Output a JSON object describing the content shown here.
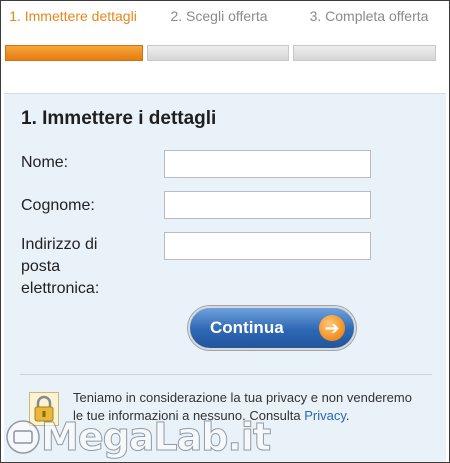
{
  "steps": [
    {
      "label": "1. Immettere dettagli",
      "active": true
    },
    {
      "label": "2. Scegli offerta",
      "active": false
    },
    {
      "label": "3. Completa offerta",
      "active": false
    }
  ],
  "form": {
    "title": "1. Immettere i dettagli",
    "first_name_label": "Nome:",
    "last_name_label": "Cognome:",
    "email_label": "Indirizzo di posta elettronica:",
    "first_name_value": "",
    "last_name_value": "",
    "email_value": "",
    "continue_label": "Continua"
  },
  "privacy": {
    "text": "Teniamo in considerazione la tua privacy e non venderemo le tue informazioni a nessuno. Consulta",
    "link": "Privacy",
    "end": "."
  },
  "watermark": {
    "text": "MegaLab.it"
  },
  "icons": {
    "arrow": "arrow-right-icon",
    "lock": "lock-icon"
  },
  "colors": {
    "accent": "#e8861a",
    "button": "#2d68b4",
    "panel": "#e9f1f9"
  }
}
